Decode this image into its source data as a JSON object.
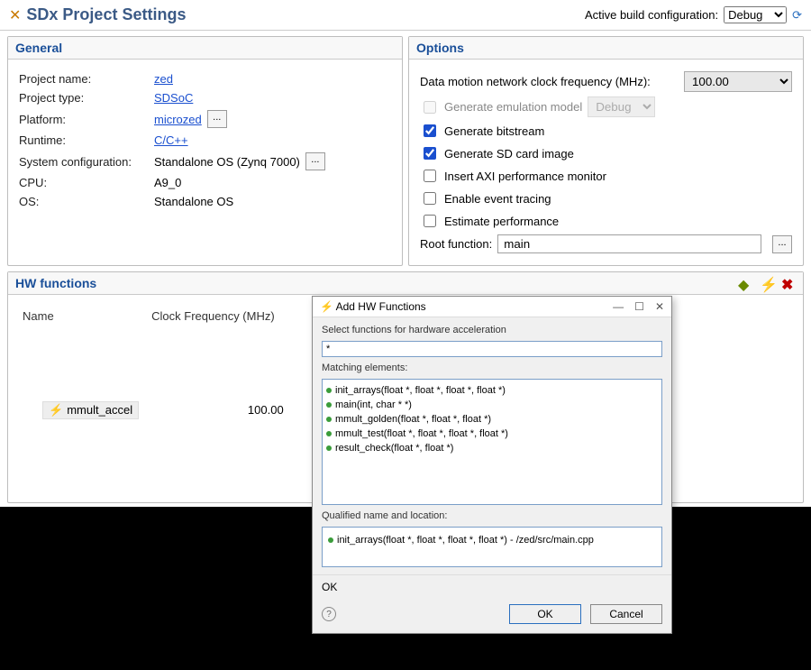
{
  "header": {
    "title": "SDx Project Settings",
    "active_config_label": "Active build configuration:",
    "active_config_value": "Debug"
  },
  "general": {
    "title": "General",
    "rows": {
      "project_name_label": "Project name:",
      "project_name": "zed",
      "project_type_label": "Project type:",
      "project_type": "SDSoC",
      "platform_label": "Platform:",
      "platform": "microzed",
      "runtime_label": "Runtime:",
      "runtime": "C/C++",
      "sysconfig_label": "System configuration:",
      "sysconfig": "Standalone OS (Zynq 7000)",
      "cpu_label": "CPU:",
      "cpu": "A9_0",
      "os_label": "OS:",
      "os": "Standalone OS"
    }
  },
  "options": {
    "title": "Options",
    "freq_label": "Data motion network clock frequency (MHz):",
    "freq_value": "100.00",
    "gen_emu_label": "Generate emulation model",
    "gen_emu_mode": "Debug",
    "gen_bitstream": "Generate bitstream",
    "gen_sd": "Generate SD card image",
    "insert_axi": "Insert AXI performance monitor",
    "enable_trace": "Enable event tracing",
    "estimate_perf": "Estimate performance",
    "root_fn_label": "Root function:",
    "root_fn_value": "main"
  },
  "hw": {
    "title": "HW functions",
    "col_name": "Name",
    "col_freq": "Clock Frequency (MHz)",
    "items": [
      {
        "name": "mmult_accel",
        "freq": "100.00"
      }
    ]
  },
  "dialog": {
    "title": "Add HW Functions",
    "prompt": "Select functions for hardware acceleration",
    "filter": "*",
    "matching_label": "Matching elements:",
    "items": [
      "init_arrays(float *, float *, float *, float *)",
      "main(int, char * *)",
      "mmult_golden(float *, float *, float *)",
      "mmult_test(float *, float *, float *, float *)",
      "result_check(float *, float *)"
    ],
    "qual_label": "Qualified name and location:",
    "qual_value": "init_arrays(float *, float *, float *, float *) - /zed/src/main.cpp",
    "status": "OK",
    "ok": "OK",
    "cancel": "Cancel"
  }
}
